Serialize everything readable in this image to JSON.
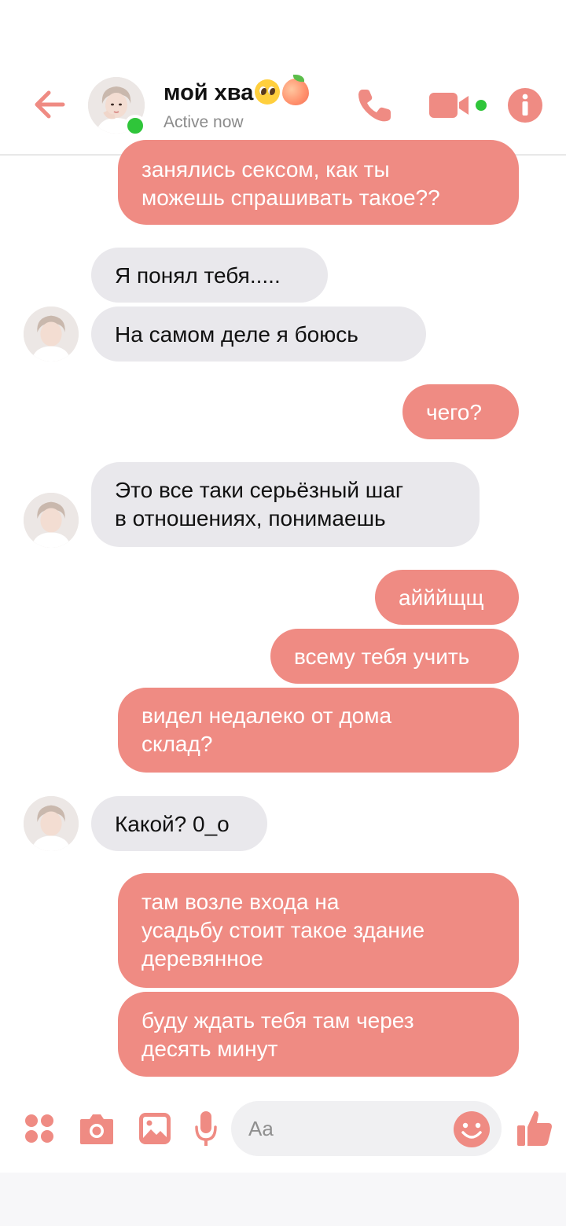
{
  "header": {
    "name": "мой хва",
    "status": "Active now",
    "accent": "#ef8b83",
    "online_color": "#2fc53a"
  },
  "messages": [
    {
      "from": "me",
      "lines": [
        "занялись сексом, как ты",
        "можешь спрашивать такое??"
      ]
    },
    {
      "from": "them",
      "lines": [
        "Я понял тебя....."
      ]
    },
    {
      "from": "them",
      "lines": [
        "На самом деле я боюсь"
      ]
    },
    {
      "from": "me",
      "lines": [
        "чего?"
      ]
    },
    {
      "from": "them",
      "lines": [
        "Это все таки серьёзный шаг",
        "в отношениях, понимаешь"
      ]
    },
    {
      "from": "me",
      "lines": [
        "айййщщ"
      ]
    },
    {
      "from": "me",
      "lines": [
        "всему тебя учить"
      ]
    },
    {
      "from": "me",
      "lines": [
        "видел недалеко от дома",
        "склад?"
      ]
    },
    {
      "from": "them",
      "lines": [
        "Какой? 0_о"
      ]
    },
    {
      "from": "me",
      "lines": [
        "там возле входа на",
        "усадьбу стоит такое здание",
        "деревянное"
      ]
    },
    {
      "from": "me",
      "lines": [
        "буду ждать тебя там через",
        "десять минут"
      ]
    }
  ],
  "composer": {
    "placeholder": "Aa",
    "icons": [
      "apps-icon",
      "camera-icon",
      "gallery-icon",
      "microphone-icon",
      "emoji-icon",
      "thumbs-up-icon"
    ]
  }
}
